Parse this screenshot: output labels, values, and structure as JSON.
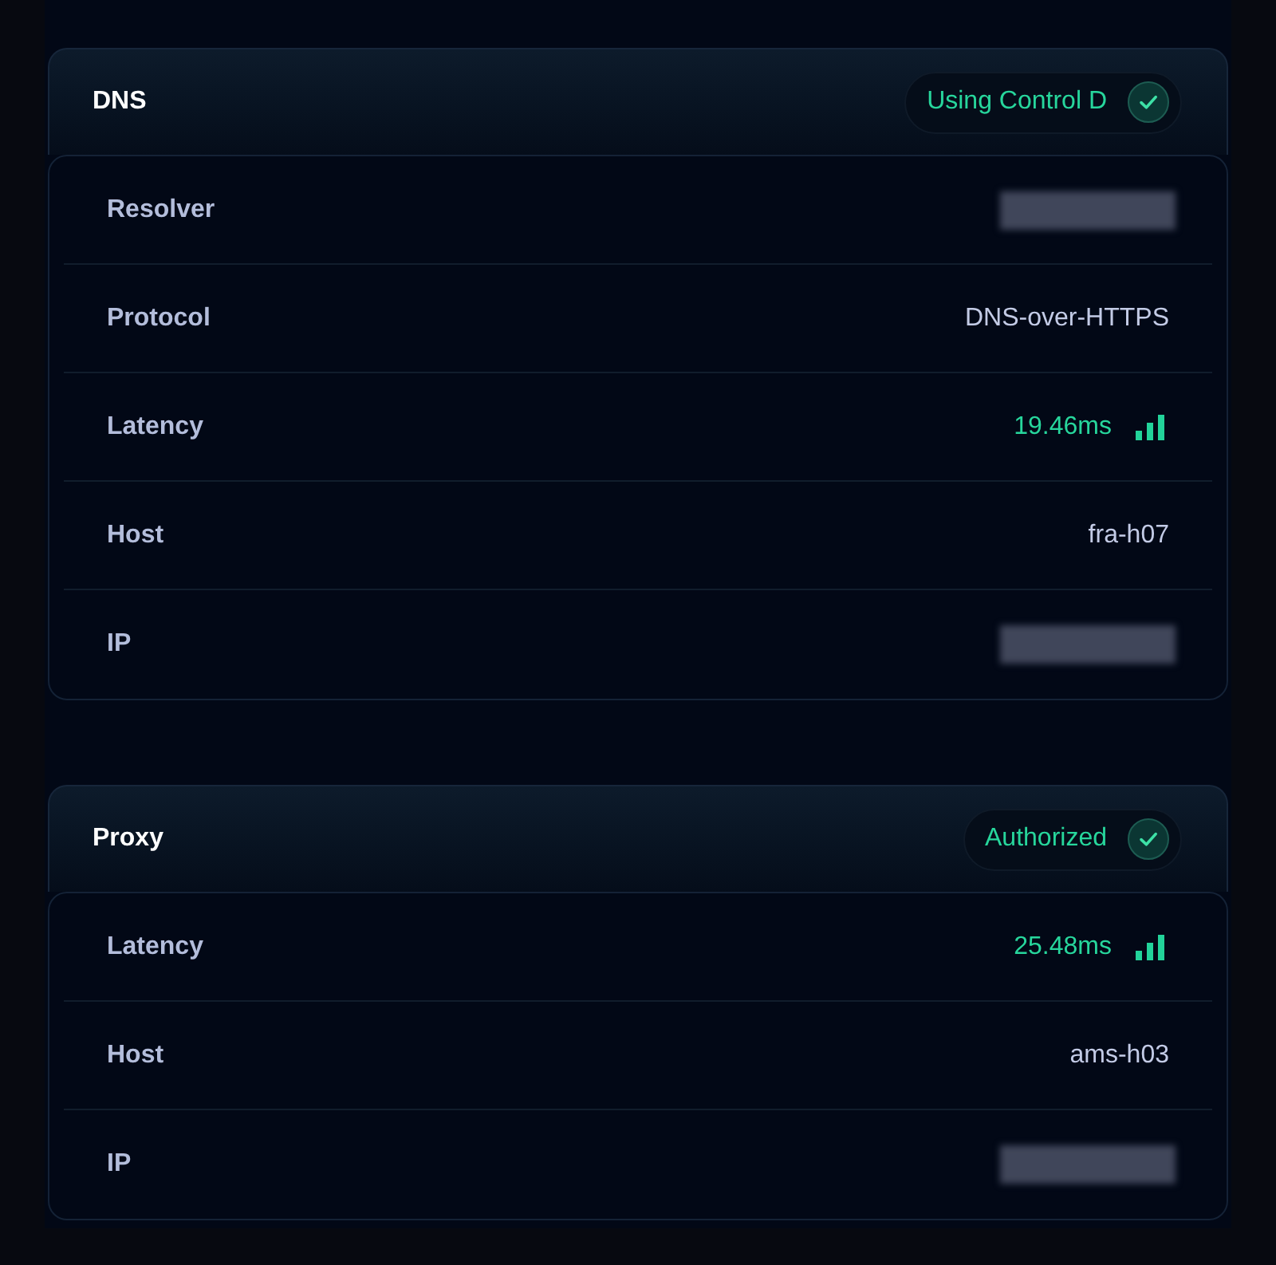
{
  "sections": [
    {
      "title": "DNS",
      "status": {
        "label": "Using Control D"
      },
      "rows": [
        {
          "label": "Resolver",
          "kind": "redacted"
        },
        {
          "label": "Protocol",
          "kind": "text",
          "value": "DNS-over-HTTPS"
        },
        {
          "label": "Latency",
          "kind": "latency",
          "value": "19.46ms"
        },
        {
          "label": "Host",
          "kind": "text",
          "value": "fra-h07"
        },
        {
          "label": "IP",
          "kind": "redacted"
        }
      ]
    },
    {
      "title": "Proxy",
      "status": {
        "label": "Authorized"
      },
      "rows": [
        {
          "label": "Latency",
          "kind": "latency",
          "value": "25.48ms"
        },
        {
          "label": "Host",
          "kind": "text",
          "value": "ams-h03"
        },
        {
          "label": "IP",
          "kind": "redacted"
        }
      ]
    }
  ]
}
